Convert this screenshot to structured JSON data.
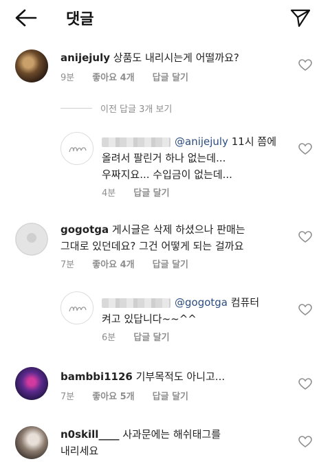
{
  "header": {
    "title": "댓글"
  },
  "comments": [
    {
      "user": "anijejuly",
      "text": "상품도 내리시는게 어떨까요?",
      "time": "9분",
      "likes": "좋아요 4개",
      "reply": "답글 달기"
    },
    {
      "mention": "@anijejuly",
      "text1": " 11시 쯤에",
      "text2": "올려서 팔린거 하나 없는데...",
      "text3": "우짜지요... 수입금이 없는데...",
      "time": "4분",
      "reply": "답글 달기"
    },
    {
      "user": "gogotga",
      "text1": " 게시글은 삭제 하셨으나 판매는",
      "text2": "그대로 있던데요? 그건 어떻게 되는 걸까요",
      "time": "7분",
      "likes": "좋아요 4개",
      "reply": "답글 달기"
    },
    {
      "mention": "@gogotga",
      "text1": " 컴퓨터",
      "text2": "켜고 있답니다~~^^",
      "time": "6분",
      "reply": "답글 달기"
    },
    {
      "user": "bambbi1126",
      "text": " 기부목적도 아니고...",
      "time": "7분",
      "likes": "좋아요 5개",
      "reply": "답글 달기"
    },
    {
      "user": "n0skill____",
      "text1": " 사과문에는 해쉬태그를",
      "text2": "내리세요"
    }
  ],
  "view_previous": "이전 답글 3개 보기"
}
